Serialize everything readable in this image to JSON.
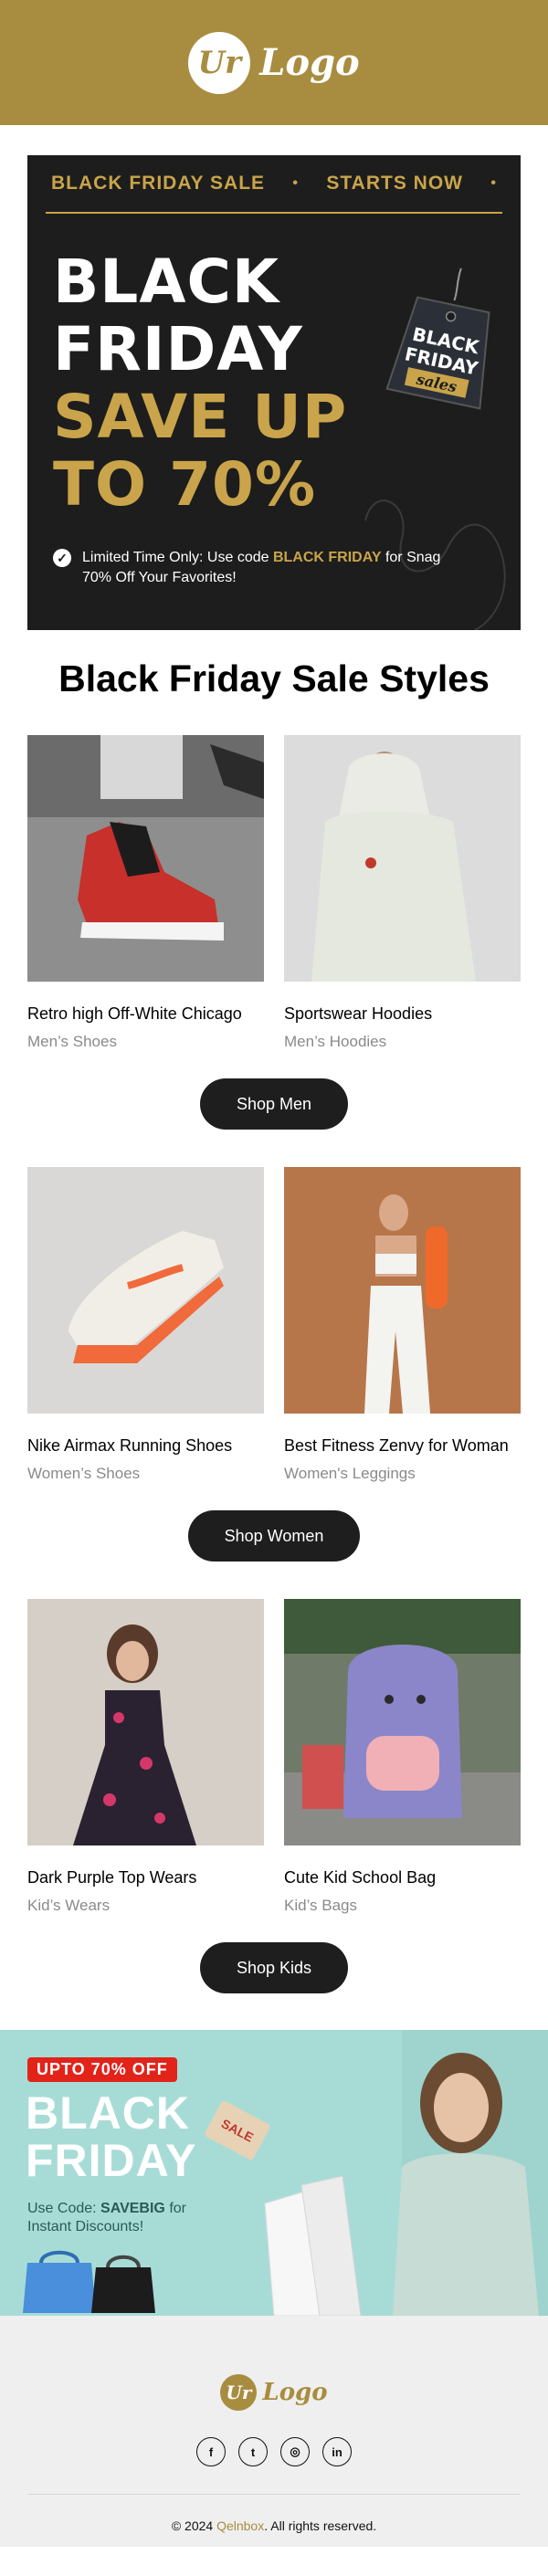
{
  "header": {
    "logo_badge": "Ur",
    "logo_text": "Logo"
  },
  "hero": {
    "top_left": "BLACK FRIDAY SALE",
    "top_dot": "•",
    "top_right": "STARTS NOW",
    "top_dot_end": "•",
    "title_line1": "BLACK",
    "title_line2": "FRIDAY",
    "title_line3": "SAVE UP",
    "title_line4": "TO 70%",
    "tag_line1": "BLACK",
    "tag_line2": "FRIDAY",
    "tag_line3": "sales",
    "note_prefix": "Limited Time Only: Use code ",
    "note_code": "BLACK FRIDAY",
    "note_suffix": " for Snag 70% Off Your Favorites!"
  },
  "section_title": "Black Friday Sale Styles",
  "rows": [
    {
      "cards": [
        {
          "name": "Retro high Off-White Chicago",
          "category": "Men’s Shoes"
        },
        {
          "name": "Sportswear Hoodies",
          "category": "Men’s Hoodies"
        }
      ],
      "button": "Shop Men"
    },
    {
      "cards": [
        {
          "name": "Nike Airmax Running Shoes",
          "category": "Women’s Shoes"
        },
        {
          "name": "Best Fitness Zenvy for Woman",
          "category": "Women's Leggings"
        }
      ],
      "button": "Shop Women"
    },
    {
      "cards": [
        {
          "name": "Dark Purple Top Wears",
          "category": "Kid’s Wears"
        },
        {
          "name": "Cute Kid School Bag",
          "category": "Kid’s Bags"
        }
      ],
      "button": "Shop Kids"
    }
  ],
  "promo": {
    "badge": "UPTO 70% OFF",
    "title_line1": "BLACK",
    "title_line2": "FRIDAY",
    "sale_tag": "SALE",
    "code_prefix": "Use Code: ",
    "code": "SAVEBIG",
    "code_suffix": " for",
    "code_line2": "Instant Discounts!"
  },
  "footer": {
    "logo_badge": "Ur",
    "logo_text": "Logo",
    "socials": [
      "f",
      "t",
      "◎",
      "in"
    ],
    "copyright_prefix": "© 2024 ",
    "copyright_brand": "Qelnbox",
    "copyright_suffix": ". All rights reserved."
  },
  "colors": {
    "gold": "#a88d40",
    "accent_gold": "#c9a44a",
    "dark": "#1d1d1d",
    "teal": "#a7dcd6",
    "red": "#e2231a"
  },
  "icons": {
    "check": "check-circle-icon",
    "social": [
      "facebook-icon",
      "twitter-icon",
      "instagram-icon",
      "linkedin-icon"
    ]
  }
}
